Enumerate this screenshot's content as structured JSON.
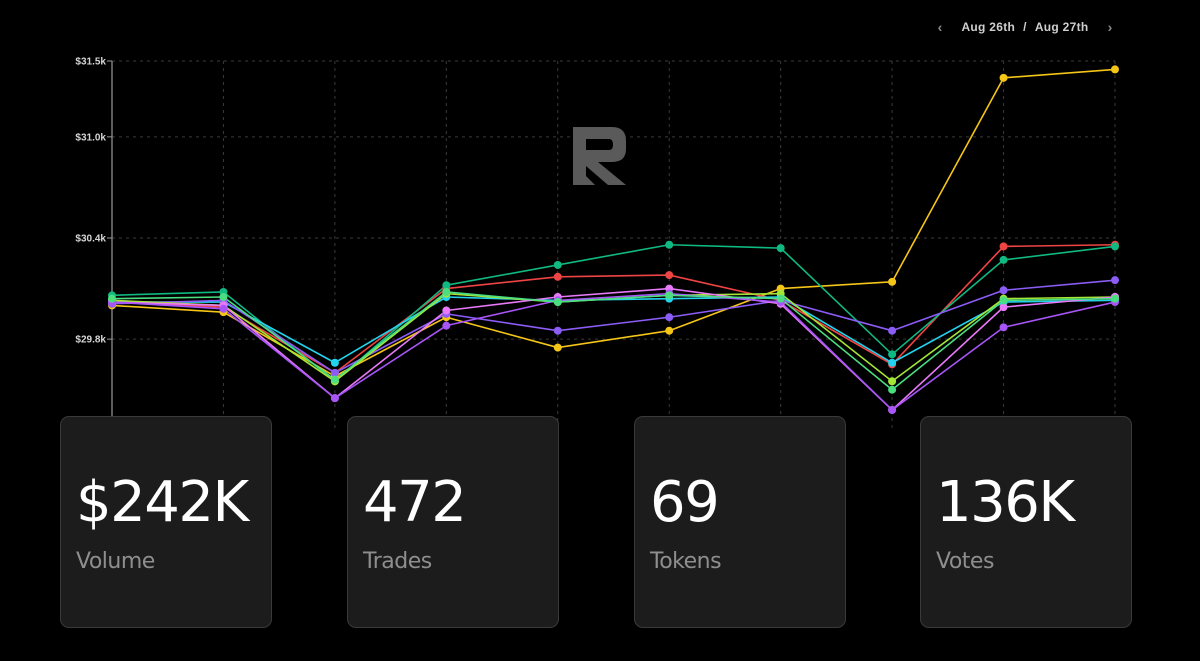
{
  "date_nav": {
    "start": "Aug 26th",
    "separator": "/",
    "end": "Aug 27th",
    "prev_icon": "chevron-left-icon",
    "next_icon": "chevron-right-icon"
  },
  "logo_icon": "r-logo-icon",
  "chart_data": {
    "type": "line",
    "x": [
      1,
      2,
      3,
      4,
      5,
      6,
      7,
      8,
      9,
      10
    ],
    "y_ticks": [
      "$29.8k",
      "$30.4k",
      "$31.0k",
      "$31.5k"
    ],
    "y_tick_values": [
      29.8,
      30.4,
      31.0,
      31.45
    ],
    "ylim": [
      29.35,
      31.45
    ],
    "grid": true,
    "legend": "none",
    "series": [
      {
        "color": "#f5c518",
        "values": [
          30.0,
          29.96,
          29.58,
          29.93,
          29.75,
          29.85,
          30.1,
          30.14,
          31.35,
          31.4
        ]
      },
      {
        "color": "#ef4444",
        "values": [
          30.02,
          29.99,
          29.6,
          30.1,
          30.17,
          30.18,
          30.03,
          29.65,
          30.35,
          30.36
        ]
      },
      {
        "color": "#10b981",
        "values": [
          30.06,
          30.08,
          29.55,
          30.12,
          30.24,
          30.36,
          30.34,
          29.71,
          30.27,
          30.35
        ]
      },
      {
        "color": "#22d3ee",
        "values": [
          30.02,
          30.02,
          29.66,
          30.05,
          30.03,
          30.04,
          30.05,
          29.66,
          30.02,
          30.03
        ]
      },
      {
        "color": "#8b5cf6",
        "values": [
          30.01,
          30.03,
          29.6,
          29.95,
          29.85,
          29.93,
          30.03,
          29.85,
          30.09,
          30.15
        ]
      },
      {
        "color": "#a3e635",
        "values": [
          30.03,
          30.0,
          29.55,
          30.07,
          30.02,
          30.06,
          30.07,
          29.55,
          30.04,
          30.05
        ]
      },
      {
        "color": "#e879f9",
        "values": [
          30.02,
          30.0,
          29.45,
          29.97,
          30.05,
          30.1,
          30.01,
          29.38,
          29.99,
          30.05
        ]
      },
      {
        "color": "#a855f7",
        "values": [
          30.02,
          29.98,
          29.45,
          29.88,
          30.03,
          30.07,
          30.02,
          29.38,
          29.87,
          30.02
        ]
      },
      {
        "color": "#4ade80",
        "values": [
          30.04,
          30.05,
          29.56,
          30.08,
          30.02,
          30.06,
          30.04,
          29.5,
          30.03,
          30.04
        ]
      }
    ]
  },
  "stats": [
    {
      "value": "$242K",
      "label": "Volume"
    },
    {
      "value": "472",
      "label": "Trades"
    },
    {
      "value": "69",
      "label": "Tokens"
    },
    {
      "value": "136K",
      "label": "Votes"
    }
  ]
}
